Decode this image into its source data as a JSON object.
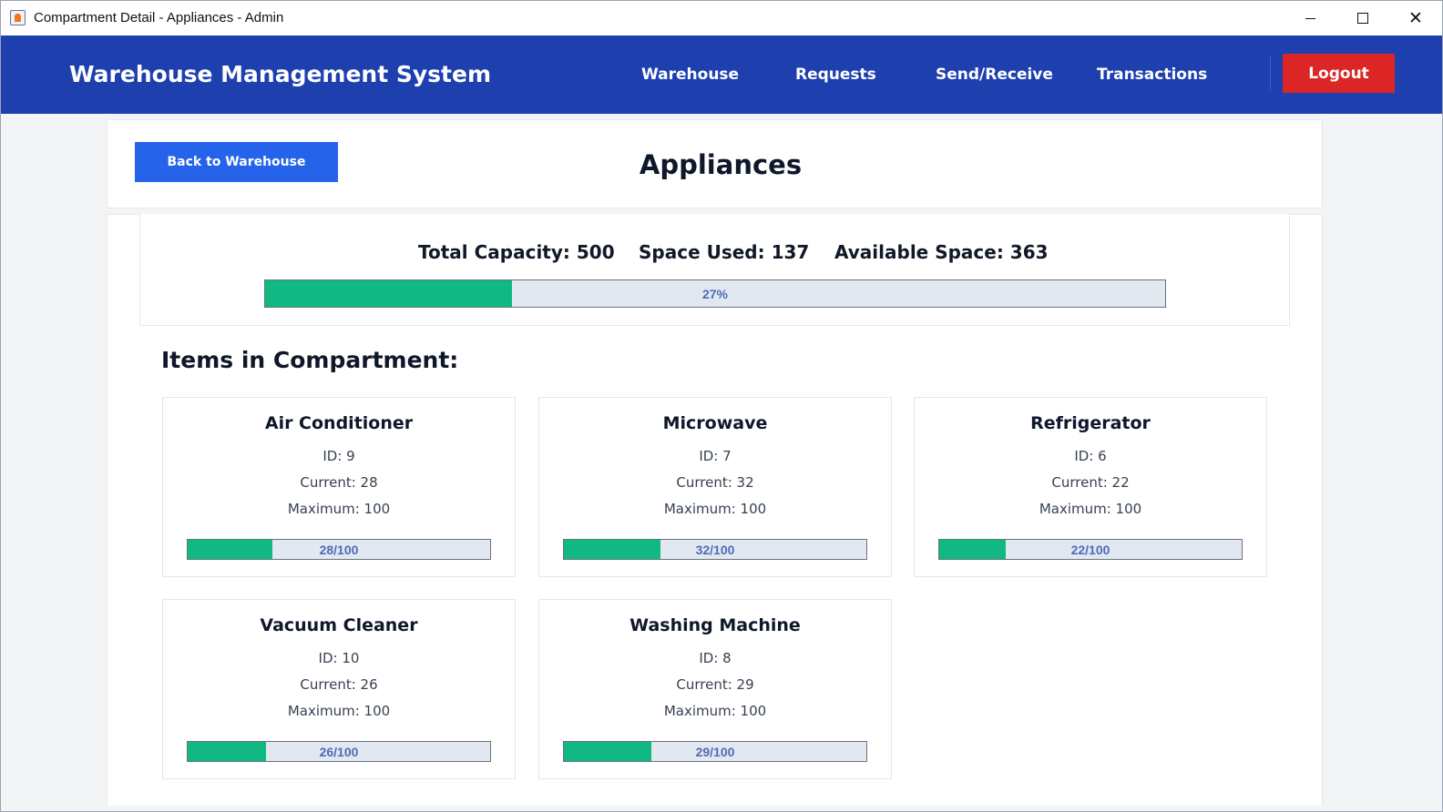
{
  "window": {
    "title": "Compartment Detail - Appliances - Admin",
    "controls": {
      "minimize": "minimize-icon",
      "maximize": "maximize-icon",
      "close": "close-icon"
    }
  },
  "navbar": {
    "brand": "Warehouse Management System",
    "items": [
      {
        "label": "Warehouse"
      },
      {
        "label": "Requests"
      },
      {
        "label": "Send/Receive"
      },
      {
        "label": "Transactions"
      }
    ],
    "logout_label": "Logout",
    "background_color": "#1e40af",
    "logout_color": "#dc2626"
  },
  "header": {
    "back_label": "Back to Warehouse",
    "title": "Appliances"
  },
  "capacity": {
    "total_text": "Total Capacity: 500",
    "used_text": "Space Used: 137",
    "available_text": "Available Space: 363",
    "total": 500,
    "used": 137,
    "available": 363,
    "percent": 27,
    "bar_label": "27%",
    "fill_color": "#10b981"
  },
  "items_heading": "Items in Compartment:",
  "items": [
    {
      "name": "Air Conditioner",
      "id_text": "ID: 9",
      "current_text": "Current: 28",
      "max_text": "Maximum: 100",
      "current": 28,
      "maximum": 100,
      "bar_label": "28/100"
    },
    {
      "name": "Microwave",
      "id_text": "ID: 7",
      "current_text": "Current: 32",
      "max_text": "Maximum: 100",
      "current": 32,
      "maximum": 100,
      "bar_label": "32/100"
    },
    {
      "name": "Refrigerator",
      "id_text": "ID: 6",
      "current_text": "Current: 22",
      "max_text": "Maximum: 100",
      "current": 22,
      "maximum": 100,
      "bar_label": "22/100"
    },
    {
      "name": "Vacuum Cleaner",
      "id_text": "ID: 10",
      "current_text": "Current: 26",
      "max_text": "Maximum: 100",
      "current": 26,
      "maximum": 100,
      "bar_label": "26/100"
    },
    {
      "name": "Washing Machine",
      "id_text": "ID: 8",
      "current_text": "Current: 29",
      "max_text": "Maximum: 100",
      "current": 29,
      "maximum": 100,
      "bar_label": "29/100"
    }
  ]
}
